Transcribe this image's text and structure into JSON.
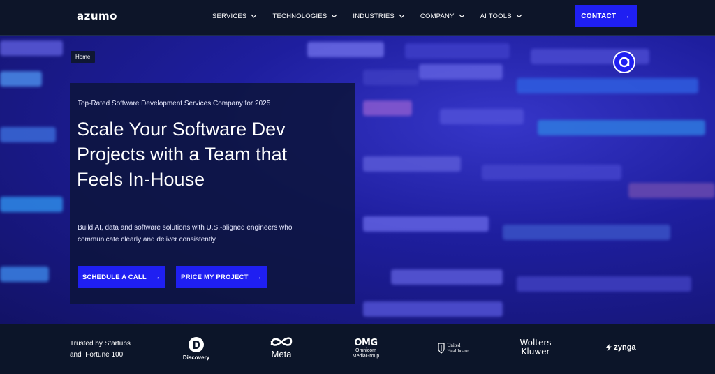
{
  "brand": {
    "name": "azumo"
  },
  "nav": {
    "items": [
      {
        "label": "SERVICES"
      },
      {
        "label": "TECHNOLOGIES"
      },
      {
        "label": "INDUSTRIES"
      },
      {
        "label": "COMPANY"
      },
      {
        "label": "AI TOOLS"
      }
    ],
    "contact_label": "CONTACT"
  },
  "breadcrumb": {
    "label": "Home"
  },
  "hero": {
    "eyebrow": "Top-Rated Software Development Services Company for 2025",
    "headline_lines": [
      "Scale Your Software Dev",
      "Projects with a Team that",
      "Feels In-House"
    ],
    "subcopy": "Build AI, data and software solutions with U.S.-aligned engineers who communicate clearly and deliver consistently.",
    "primary_cta": "SCHEDULE A CALL",
    "secondary_cta": "PRICE MY PROJECT"
  },
  "trust": {
    "text_line1": "Trusted by Startups",
    "text_line2": "and  Fortune 100",
    "logos": {
      "discovery": "Discovery",
      "meta": "Meta",
      "omnicom_big": "OMG",
      "omnicom_small_1": "Omnicom",
      "omnicom_small_2": "MediaGroup",
      "uhc_1": "United",
      "uhc_2": "Healthcare",
      "wk_1": "Wolters",
      "wk_2": "Kluwer",
      "zynga": "zynga"
    }
  },
  "colors": {
    "accent": "#1f1ff2",
    "nav_bg": "#0d1529",
    "card_bg": "#0d143e"
  }
}
